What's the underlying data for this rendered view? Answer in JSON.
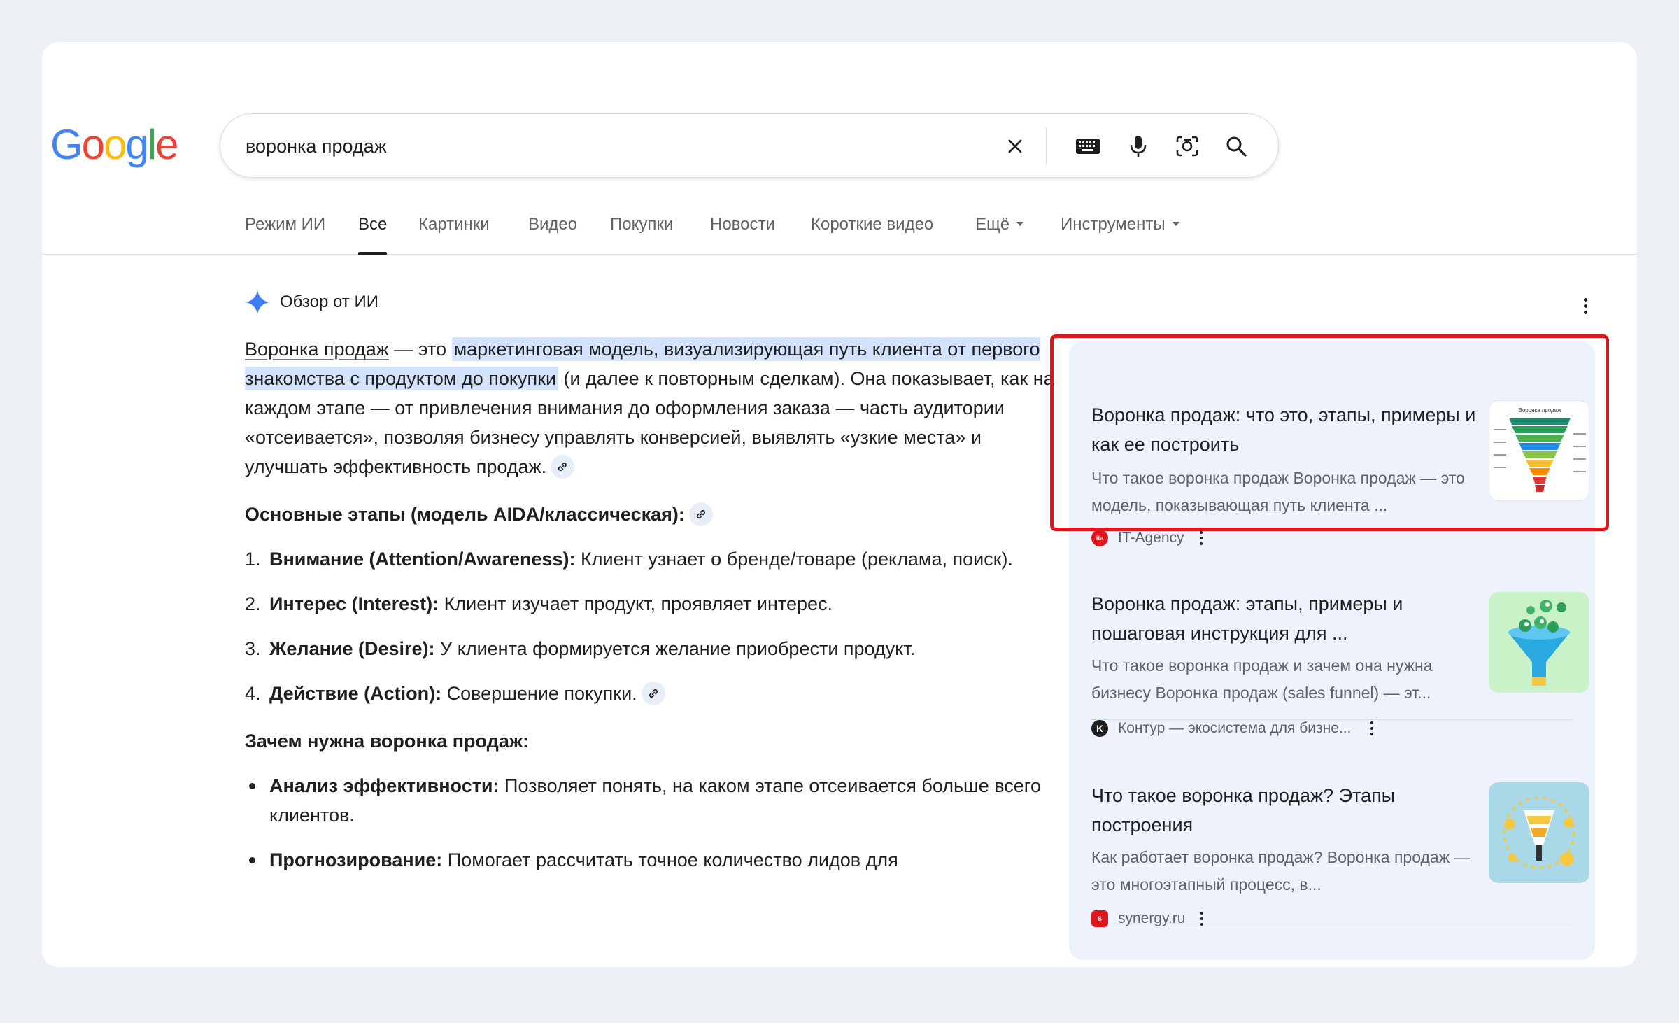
{
  "logo": [
    "G",
    "o",
    "o",
    "g",
    "l",
    "e"
  ],
  "logo_colors": [
    "#4285f4",
    "#ea4335",
    "#fbbc05",
    "#4285f4",
    "#34a853",
    "#ea4335"
  ],
  "search": {
    "query": "воронка продаж"
  },
  "tabs": [
    {
      "label": "Режим ИИ"
    },
    {
      "label": "Все",
      "active": true
    },
    {
      "label": "Картинки"
    },
    {
      "label": "Видео"
    },
    {
      "label": "Покупки"
    },
    {
      "label": "Новости"
    },
    {
      "label": "Короткие видео"
    },
    {
      "label": "Ещё",
      "dropdown": true
    },
    {
      "label": "Инструменты",
      "dropdown": true
    }
  ],
  "ai_overview": {
    "title": "Обзор от ИИ",
    "intro": {
      "term": "Воронка продаж",
      "dash": " — это ",
      "highlight": "маркетинговая модель, визуализирующая путь клиента от первого знакомства с продуктом до покупки",
      "rest": " (и далее к повторным сделкам). Она показывает, как на каждом этапе — от привлечения внимания до оформления заказа — часть аудитории «отсеивается», позволяя бизнесу управлять конверсией, выявлять «узкие места» и улучшать эффективность продаж."
    },
    "stages_heading": "Основные этапы (модель AIDA/классическая):",
    "stages": [
      {
        "num": "1.",
        "bold": "Внимание (Attention/Awareness):",
        "text": " Клиент узнает о бренде/товаре (реклама, поиск)."
      },
      {
        "num": "2.",
        "bold": "Интерес (Interest):",
        "text": " Клиент изучает продукт, проявляет интерес."
      },
      {
        "num": "3.",
        "bold": "Желание (Desire):",
        "text": " У клиента формируется желание приобрести продукт."
      },
      {
        "num": "4.",
        "bold": "Действие (Action):",
        "text": " Совершение покупки."
      }
    ],
    "why_heading": "Зачем нужна воронка продаж:",
    "reasons": [
      {
        "bold": "Анализ эффективности:",
        "text": " Позволяет понять, на каком этапе отсеивается больше всего клиентов."
      },
      {
        "bold": "Прогнозирование:",
        "text": " Помогает рассчитать точное количество лидов для"
      }
    ]
  },
  "results": [
    {
      "title": "Воронка продаж: что это, этапы, примеры и как ее построить",
      "snippet": "Что такое воронка продаж Воронка продаж — это модель, показывающая путь клиента ...",
      "source": "IT-Agency",
      "favicon_text": "ita",
      "favicon_color": "#e0161d",
      "thumb_label": "Воронка продаж"
    },
    {
      "title": "Воронка продаж: этапы, примеры и пошаговая инструкция для ...",
      "snippet": "Что такое воронка продаж и зачем она нужна бизнесу Воронка продаж (sales funnel) — эт...",
      "source": "Контур — экосистема для бизне...",
      "favicon_text": "K",
      "favicon_color": "#1f1f1f"
    },
    {
      "title": "Что такое воронка продаж? Этапы построения",
      "snippet": "Как работает воронка продаж? Воронка продаж — это многоэтапный процесс, в...",
      "source": "synergy.ru",
      "favicon_text": "S",
      "favicon_color": "#e0161d"
    }
  ],
  "highlight_color": "#e0161d"
}
